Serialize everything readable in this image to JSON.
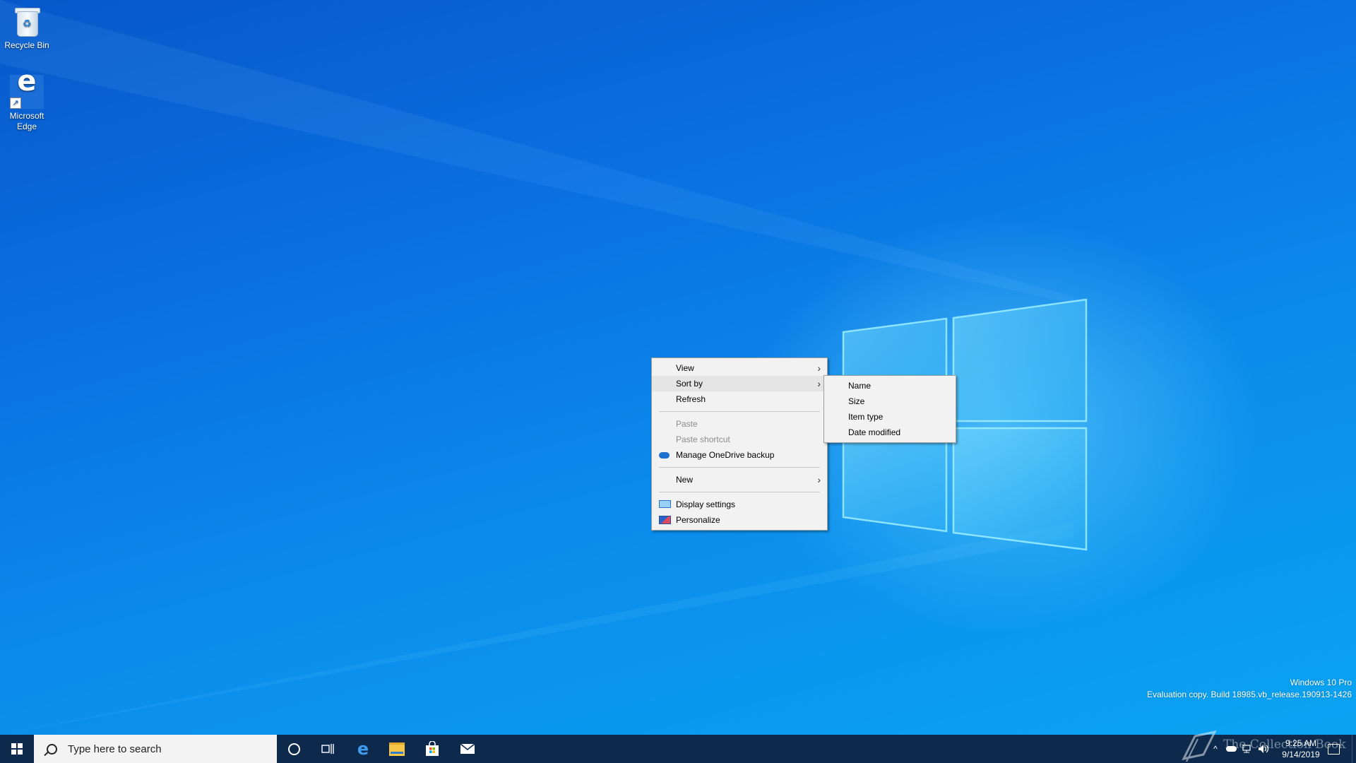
{
  "desktop": {
    "icons": [
      {
        "label": "Recycle Bin",
        "icon": "recycle-bin-icon"
      },
      {
        "label": "Microsoft Edge",
        "icon": "edge-icon"
      }
    ]
  },
  "context_menu": {
    "items": [
      {
        "label": "View",
        "has_submenu": true
      },
      {
        "label": "Sort by",
        "has_submenu": true,
        "highlighted": true
      },
      {
        "label": "Refresh"
      },
      {
        "label": "Paste",
        "disabled": true
      },
      {
        "label": "Paste shortcut",
        "disabled": true
      },
      {
        "label": "Manage OneDrive backup",
        "icon": "onedrive-icon"
      },
      {
        "label": "New",
        "has_submenu": true
      },
      {
        "label": "Display settings",
        "icon": "display-settings-icon"
      },
      {
        "label": "Personalize",
        "icon": "personalize-icon"
      }
    ]
  },
  "sortby_submenu": {
    "items": [
      {
        "label": "Name"
      },
      {
        "label": "Size"
      },
      {
        "label": "Item type"
      },
      {
        "label": "Date modified"
      }
    ]
  },
  "watermark": {
    "edition": "Windows 10 Pro",
    "build": "Evaluation copy. Build 18985.vb_release.190913-1426"
  },
  "taskbar": {
    "search_placeholder": "Type here to search",
    "pinned": [
      "cortana-icon",
      "task-view-icon",
      "edge-icon",
      "file-explorer-icon",
      "store-icon",
      "mail-icon"
    ]
  },
  "tray": {
    "time": "9:25 AM",
    "date": "9/14/2019"
  },
  "overlay": {
    "logo_text": "The Collection Book"
  },
  "colors": {
    "taskbar": "#0d2a4d",
    "menu_bg": "#f2f2f2",
    "menu_highlight": "#e5e5e5",
    "desktop_blue": "#0a6fe0"
  }
}
